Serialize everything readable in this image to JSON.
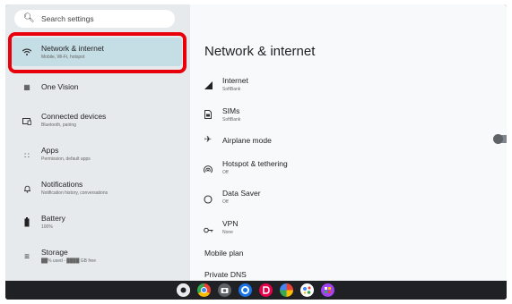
{
  "search": {
    "placeholder": "Search settings",
    "icon": "search-icon"
  },
  "sidebar": {
    "items": [
      {
        "label": "Network & internet",
        "sub": "Mobile, Wi-Fi, hotspot",
        "icon": "wifi-icon",
        "selected": true
      },
      {
        "label": "One Vision",
        "sub": "",
        "icon": "grid-icon"
      },
      {
        "label": "Connected devices",
        "sub": "Bluetooth, pairing",
        "icon": "devices-icon"
      },
      {
        "label": "Apps",
        "sub": "Permission, default apps",
        "icon": "apps-icon"
      },
      {
        "label": "Notifications",
        "sub": "Notification history, conversations",
        "icon": "bell-icon"
      },
      {
        "label": "Battery",
        "sub": "100%",
        "icon": "battery-icon"
      },
      {
        "label": "Storage",
        "sub": "██% used - ████ GB free",
        "icon": "storage-icon"
      }
    ]
  },
  "main": {
    "title": "Network & internet",
    "items": [
      {
        "label": "Internet",
        "sub": "SoftBank",
        "icon": "signal-icon"
      },
      {
        "label": "SIMs",
        "sub": "SoftBank",
        "icon": "sim-icon"
      },
      {
        "label": "Airplane mode",
        "sub": "",
        "icon": "airplane-icon",
        "toggle": "off"
      },
      {
        "label": "Hotspot & tethering",
        "sub": "Off",
        "icon": "hotspot-icon"
      },
      {
        "label": "Data Saver",
        "sub": "Off",
        "icon": "data-saver-icon"
      },
      {
        "label": "VPN",
        "sub": "None",
        "icon": "vpn-key-icon"
      },
      {
        "label": "Mobile plan",
        "sub": "",
        "icon": ""
      },
      {
        "label": "Private DNS",
        "sub": "",
        "icon": ""
      }
    ]
  },
  "shelf": {
    "apps": [
      {
        "name": "launcher-icon",
        "color": "#e8eaed"
      },
      {
        "name": "chrome-icon",
        "color": "#fbbc04"
      },
      {
        "name": "camera-icon",
        "color": "#5f6368"
      },
      {
        "name": "settings-icon",
        "color": "#1a73e8"
      },
      {
        "name": "app-d-icon",
        "color": "#e8004c"
      },
      {
        "name": "photos-icon",
        "color": "#34a853"
      },
      {
        "name": "assistant-icon",
        "color": "#4285f4"
      },
      {
        "name": "app-icon",
        "color": "#a142f4"
      }
    ]
  },
  "colors": {
    "highlight": "#e8000b",
    "selected_bg": "#c5dde5"
  }
}
